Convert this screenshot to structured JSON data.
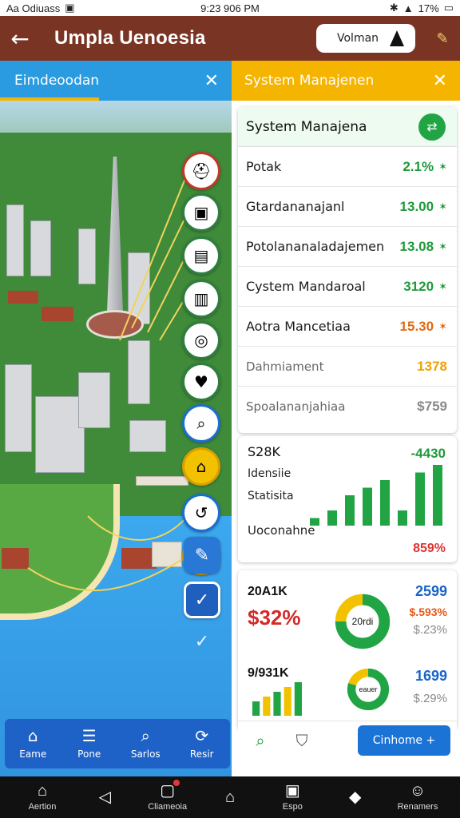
{
  "status_bar": {
    "left_text": "Aa Odiuass",
    "time": "9:23 906 PM",
    "battery": "17%"
  },
  "app_bar": {
    "title": "Umpla Uenoesia",
    "pill_label": "Volman"
  },
  "left_panel": {
    "header_title": "Eimdeoodan",
    "bottom_nav": [
      {
        "label": "Eame",
        "icon": "home-icon"
      },
      {
        "label": "Pone",
        "icon": "list-icon"
      },
      {
        "label": "Sarlos",
        "icon": "search-icon"
      },
      {
        "label": "Resir",
        "icon": "refresh-icon"
      }
    ]
  },
  "right_panel": {
    "header_title": "System Manajenen",
    "list_card": {
      "title": "System Manajena",
      "rows": [
        {
          "label": "Potak",
          "value": "2.1%",
          "color": "#1f9a3b"
        },
        {
          "label": "Gtardananajanl",
          "value": "13.00",
          "color": "#1f9a3b"
        },
        {
          "label": "Potolananaladajemen",
          "value": "13.08",
          "color": "#1f9a3b"
        },
        {
          "label": "Cystem Mandaroal",
          "value": "3120",
          "color": "#1f9a3b"
        },
        {
          "label": "Aotra Mancetiaa",
          "value": "15.30",
          "color": "#e06a12"
        },
        {
          "label": "Dahmiament",
          "value": "1378",
          "color": "#f0a000"
        },
        {
          "label": "Spoalananjahiaa",
          "value": "$759",
          "color": "#8a8a8a"
        }
      ]
    },
    "chart_card": {
      "k_label": "S28K",
      "line2": "Idensiie",
      "line3": "Statisita",
      "line4": "Uoconahne",
      "top_value": "-4430",
      "bottom_value": "859%",
      "chart_data": {
        "type": "bar",
        "values": [
          1,
          2,
          4,
          5,
          6,
          2,
          7,
          8
        ],
        "ylim": [
          0,
          8
        ]
      }
    },
    "donut_card": {
      "k1": "20A1K",
      "p1": "$32%",
      "k2": "9/931K",
      "r1_blue": "2599",
      "r1_orange": "$.593%",
      "r1_gray": "$.23%",
      "r2_blue": "1699",
      "r2_gray": "$.29%",
      "donut1_label": "20rdi",
      "donut2_label": "eauer",
      "chart_data": [
        {
          "type": "pie",
          "values": [
            75,
            25
          ]
        },
        {
          "type": "pie",
          "values": [
            80,
            20
          ]
        },
        {
          "type": "bar",
          "values": [
            3,
            4,
            5,
            6,
            7
          ]
        }
      ]
    },
    "action_button": "Cinhome +"
  },
  "system_nav": [
    {
      "label": "Aertion",
      "icon": "bell-icon"
    },
    {
      "label": "",
      "icon": "back-icon"
    },
    {
      "label": "Cliameoia",
      "icon": "calendar-icon"
    },
    {
      "label": "",
      "icon": "home-outline-icon"
    },
    {
      "label": "Espo",
      "icon": "image-icon"
    },
    {
      "label": "",
      "icon": "location-icon"
    },
    {
      "label": "Renamers",
      "icon": "profile-icon"
    }
  ],
  "colors": {
    "appbar": "#7a3424",
    "left_header": "#2a9be0",
    "right_header": "#f5b400",
    "accent_green": "#1f9a3b",
    "accent_blue": "#1b73d6"
  }
}
